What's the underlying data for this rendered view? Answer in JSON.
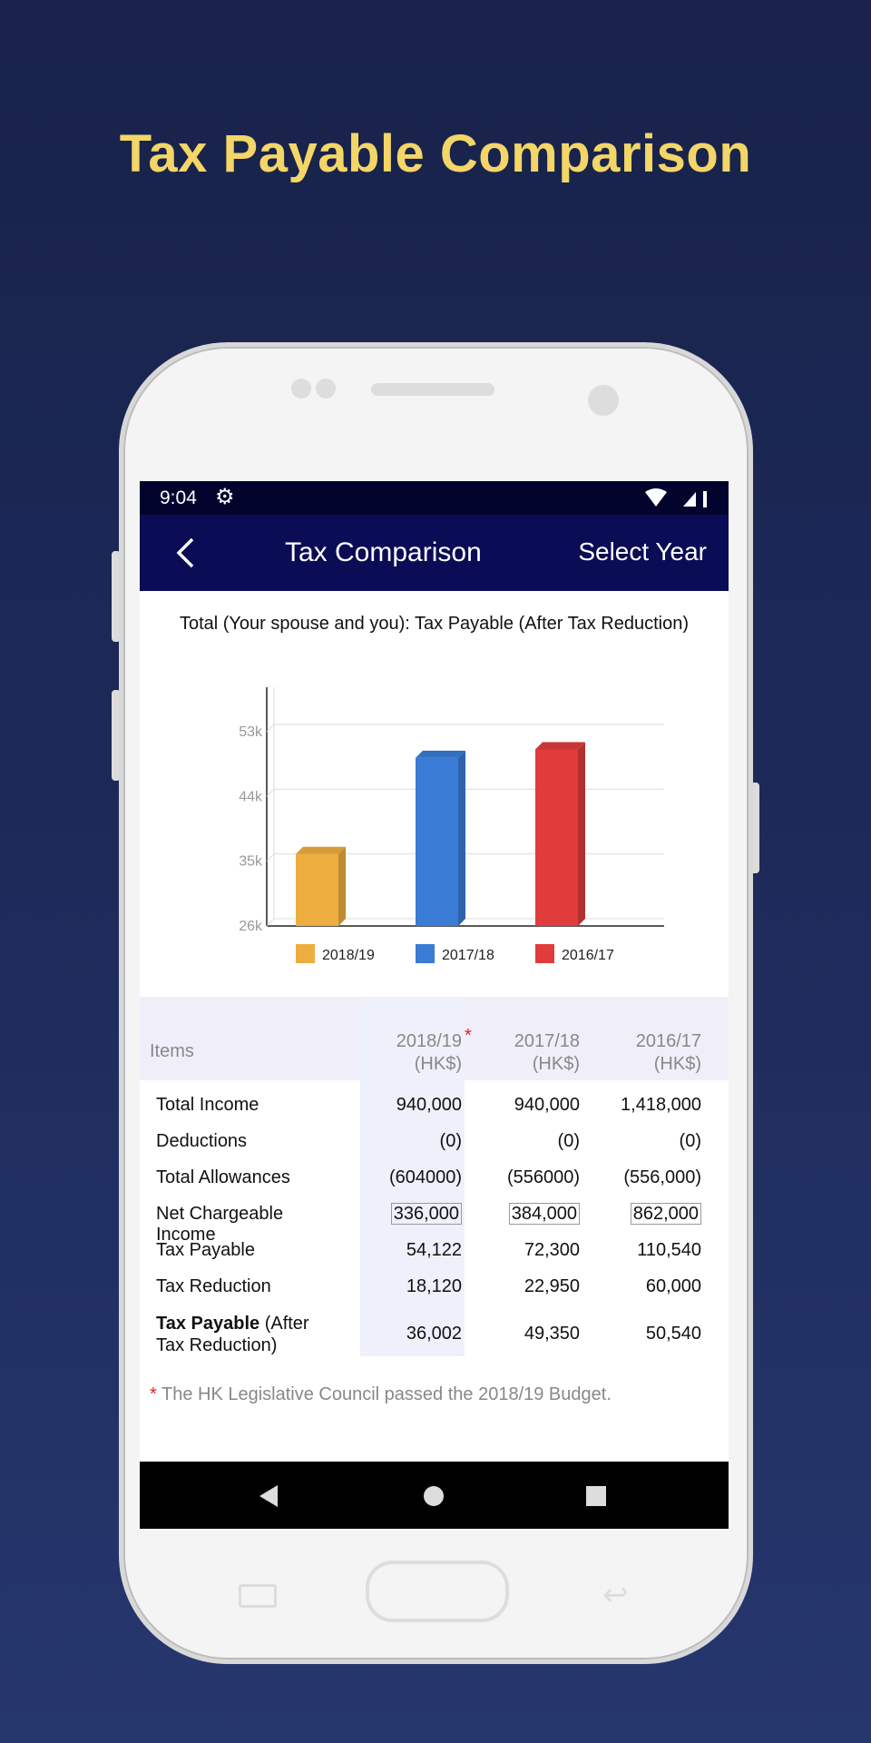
{
  "promo": {
    "title": "Tax Payable Comparison"
  },
  "status_bar": {
    "time": "9:04",
    "icons": [
      "gear-icon",
      "wifi-icon",
      "signal-icon",
      "battery-charging-icon"
    ]
  },
  "app_bar": {
    "back_icon": "chevron-left-icon",
    "title": "Tax Comparison",
    "action": "Select Year"
  },
  "chart_title": "Total (Your spouse and you): Tax Payable (After Tax Reduction)",
  "chart_data": {
    "type": "bar",
    "categories": [
      "2018/19",
      "2017/18",
      "2016/17"
    ],
    "values": [
      36002,
      49350,
      50540
    ],
    "colors": [
      "#eeae3f",
      "#3a7bd5",
      "#e03c3c"
    ],
    "yticks": [
      "26k",
      "35k",
      "44k",
      "53k"
    ],
    "ylim": [
      26000,
      60000
    ],
    "grid": true,
    "legend": "bottom",
    "style": "3d"
  },
  "pager": {
    "pages": 3,
    "active": 0
  },
  "table": {
    "headers": {
      "items": "Items",
      "cols": [
        {
          "year": "2018/19",
          "unit": "(HK$)",
          "mark": "*"
        },
        {
          "year": "2017/18",
          "unit": "(HK$)",
          "mark": ""
        },
        {
          "year": "2016/17",
          "unit": "(HK$)",
          "mark": ""
        }
      ]
    },
    "rows": [
      {
        "label": "Total Income",
        "values": [
          "940,000",
          "940,000",
          "1,418,000"
        ]
      },
      {
        "label": "Deductions",
        "values": [
          "(0)",
          "(0)",
          "(0)"
        ]
      },
      {
        "label": "Total Allowances",
        "values": [
          "(604000)",
          "(556000)",
          "(556,000)"
        ]
      },
      {
        "label": "Net Chargeable Income",
        "values": [
          "336,000",
          "384,000",
          "862,000"
        ]
      },
      {
        "label": "Tax Payable",
        "values": [
          "54,122",
          "72,300",
          "110,540"
        ]
      },
      {
        "label": "Tax Reduction",
        "values": [
          "18,120",
          "22,950",
          "60,000"
        ]
      },
      {
        "label_bold": "Tax Payable",
        "label": " (After Tax Reduction)",
        "values": [
          "36,002",
          "49,350",
          "50,540"
        ]
      }
    ]
  },
  "footnote": {
    "mark": "*",
    "text": " The HK Legislative Council passed the 2018/19 Budget."
  },
  "colors": {
    "status_bar": "#03042e",
    "app_bar": "#0a0d55",
    "promo_title": "#f3d667",
    "header_band": "#f0eff9"
  }
}
